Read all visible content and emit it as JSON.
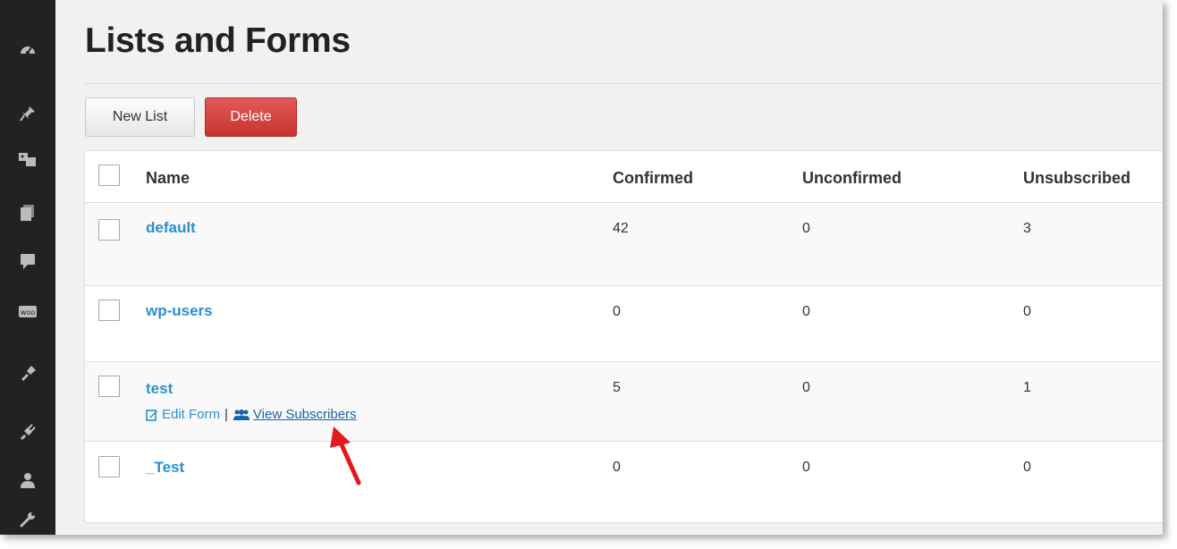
{
  "page": {
    "title": "Lists and Forms"
  },
  "toolbar": {
    "new_list_label": "New List",
    "delete_label": "Delete"
  },
  "sidebar": {
    "icons": [
      "dashboard-icon",
      "pin-icon",
      "media-icon",
      "pages-icon",
      "comments-icon",
      "woo-icon",
      "appearance-icon",
      "plugins-icon",
      "users-icon",
      "tools-icon"
    ],
    "background_color": "#222222"
  },
  "table": {
    "columns": [
      "Name",
      "Confirmed",
      "Unconfirmed",
      "Unsubscribed"
    ],
    "rows": [
      {
        "name": "default",
        "confirmed": "42",
        "unconfirmed": "0",
        "unsubscribed": "3"
      },
      {
        "name": "wp-users",
        "confirmed": "0",
        "unconfirmed": "0",
        "unsubscribed": "0"
      },
      {
        "name": "test",
        "confirmed": "5",
        "unconfirmed": "0",
        "unsubscribed": "1",
        "actions": {
          "edit_form": "Edit Form",
          "separator": "|",
          "view_subscribers": "View Subscribers"
        }
      },
      {
        "name": "_Test",
        "confirmed": "0",
        "unconfirmed": "0",
        "unsubscribed": "0"
      }
    ]
  },
  "colors": {
    "link": "#2a8fd0",
    "delete_button": "#d9443f",
    "annotation_arrow": "#e4191d"
  }
}
